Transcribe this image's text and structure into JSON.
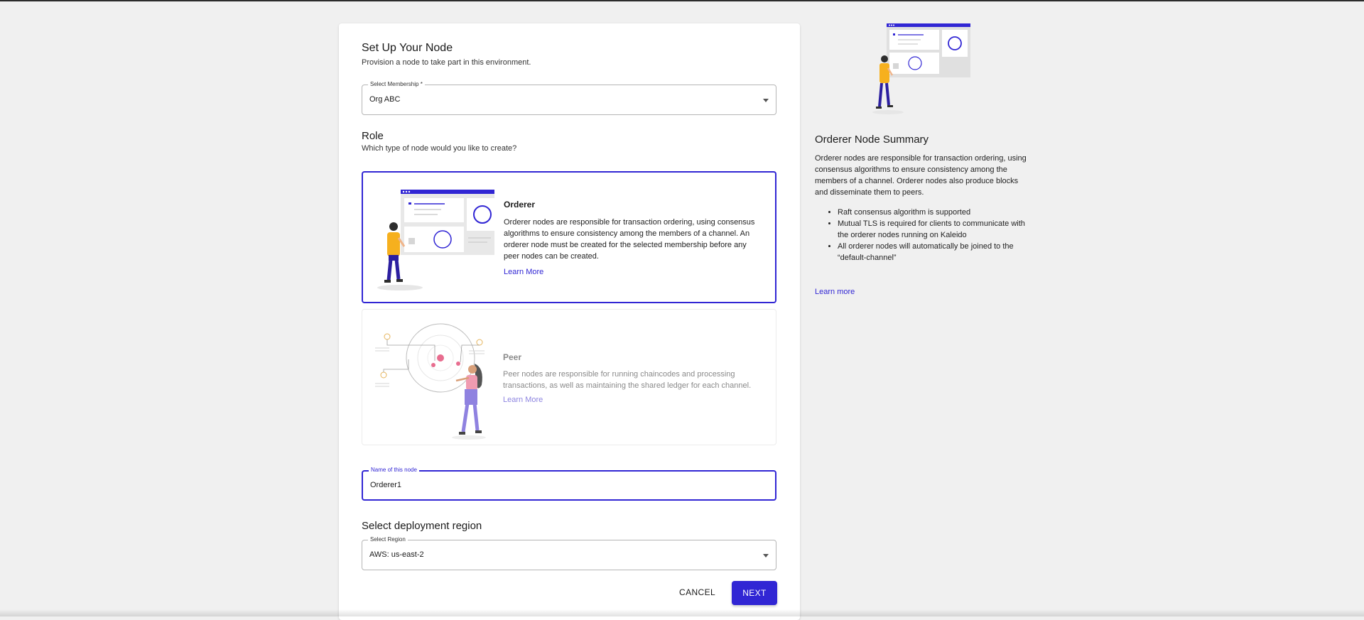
{
  "setup": {
    "title": "Set Up Your Node",
    "subtitle": "Provision a node to take part in this environment."
  },
  "membership": {
    "label": "Select Membership *",
    "value": "Org ABC"
  },
  "role": {
    "title": "Role",
    "subtitle": "Which type of node would you like to create?",
    "options": [
      {
        "name": "Orderer",
        "description": "Orderer nodes are responsible for transaction ordering, using consensus algorithms to ensure consistency among the members of a channel. An orderer node must be created for the selected membership before any peer nodes can be created.",
        "link": "Learn More",
        "selected": true
      },
      {
        "name": "Peer",
        "description": "Peer nodes are responsible for running chaincodes and processing transactions, as well as maintaining the shared ledger for each channel.",
        "link": "Learn More",
        "selected": false
      }
    ]
  },
  "node_name": {
    "label": "Name of this node",
    "value": "Orderer1"
  },
  "region": {
    "title": "Select deployment region",
    "label": "Select Region",
    "value": "AWS: us-east-2"
  },
  "actions": {
    "cancel": "CANCEL",
    "next": "NEXT"
  },
  "summary": {
    "title": "Orderer Node Summary",
    "description": "Orderer nodes are responsible for transaction ordering, using consensus algorithms to ensure consistency among the members of a channel. Orderer nodes also produce blocks and disseminate them to peers.",
    "bullets": [
      "Raft consensus algorithm is supported",
      "Mutual TLS is required for clients to communicate with the orderer nodes running on Kaleido",
      "All orderer nodes will automatically be joined to the “default-channel”"
    ],
    "link": "Learn more"
  },
  "colors": {
    "accent": "#3126d4",
    "illustration_yellow": "#f6b01e",
    "peer_pink": "#e86d8f"
  }
}
